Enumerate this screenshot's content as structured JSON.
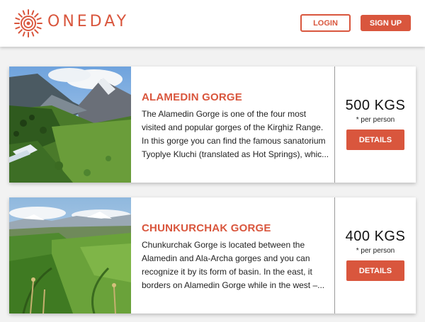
{
  "header": {
    "brand": "ONEDAY",
    "login_label": "LOGIN",
    "signup_label": "SIGN UP",
    "logo_icon": "sun-spiral-logo",
    "accent_color": "#d9563d"
  },
  "tours": [
    {
      "title": "ALAMEDIN GORGE",
      "description": "The Alamedin Gorge is one of the four most visited and popular gorges of the Kirghiz Range. In this gorge you can find the famous sanatorium Tyoplye Kluchi (translated as Hot Springs), whic...",
      "price": "500 KGS",
      "price_note": "* per person",
      "details_label": "DETAILS"
    },
    {
      "title": "CHUNKURCHAK GORGE",
      "description": "Chunkurchak Gorge is located between the Alamedin and Ala-Archa gorges and you can recognize it by its form of basin. In the east, it borders on Alamedin Gorge while in the west –...",
      "price": "400 KGS",
      "price_note": "* per person",
      "details_label": "DETAILS"
    }
  ]
}
